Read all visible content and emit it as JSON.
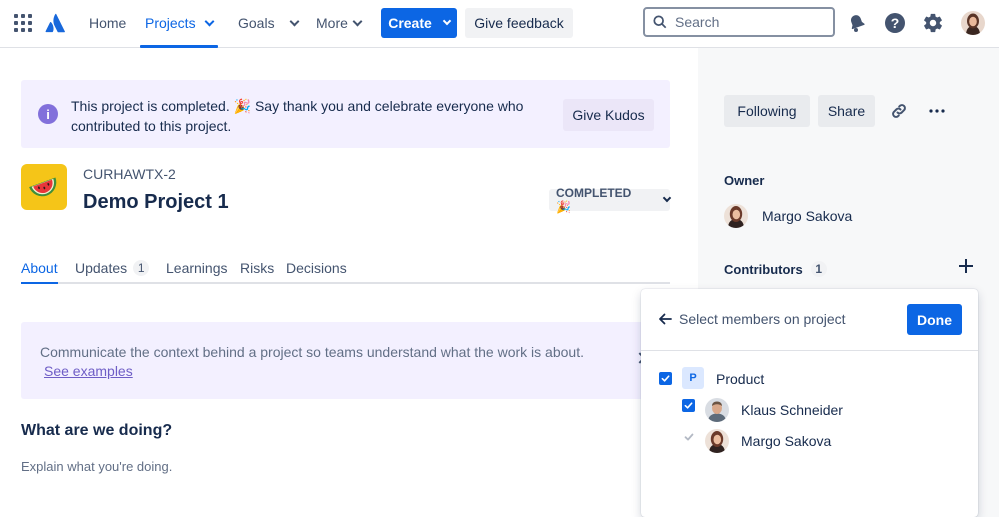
{
  "nav": {
    "home": "Home",
    "projects": "Projects",
    "goals": "Goals",
    "more": "More",
    "create": "Create",
    "feedback": "Give feedback",
    "search_placeholder": "Search"
  },
  "banner": {
    "message": "This project is completed. 🎉 Say thank you and celebrate everyone who contributed to this project.",
    "kudos": "Give Kudos"
  },
  "project": {
    "key": "CURHAWTX-2",
    "name": "Demo Project 1",
    "status": "COMPLETED 🎉",
    "icon": "watermelon"
  },
  "tabs": [
    {
      "label": "About"
    },
    {
      "label": "Updates",
      "count": "1"
    },
    {
      "label": "Learnings"
    },
    {
      "label": "Risks"
    },
    {
      "label": "Decisions"
    }
  ],
  "context": {
    "text": "Communicate the context behind a project so teams understand what the work is about.",
    "link": "See examples"
  },
  "section": {
    "title": "What are we doing?",
    "body": "Explain what you're doing."
  },
  "right": {
    "following": "Following",
    "share": "Share",
    "owner_label": "Owner",
    "owner_name": "Margo Sakova",
    "contributors_label": "Contributors",
    "contributors_count": "1"
  },
  "popup": {
    "title": "Select members on project",
    "done": "Done",
    "group": {
      "badge": "P",
      "name": "Product"
    },
    "members": [
      {
        "name": "Klaus Schneider",
        "checked": true
      },
      {
        "name": "Margo Sakova",
        "checked": true,
        "disabled": true
      }
    ]
  },
  "colors": {
    "accent": "#0c66e4",
    "banner_bg": "#f3f0ff",
    "info_purple": "#8270db"
  }
}
